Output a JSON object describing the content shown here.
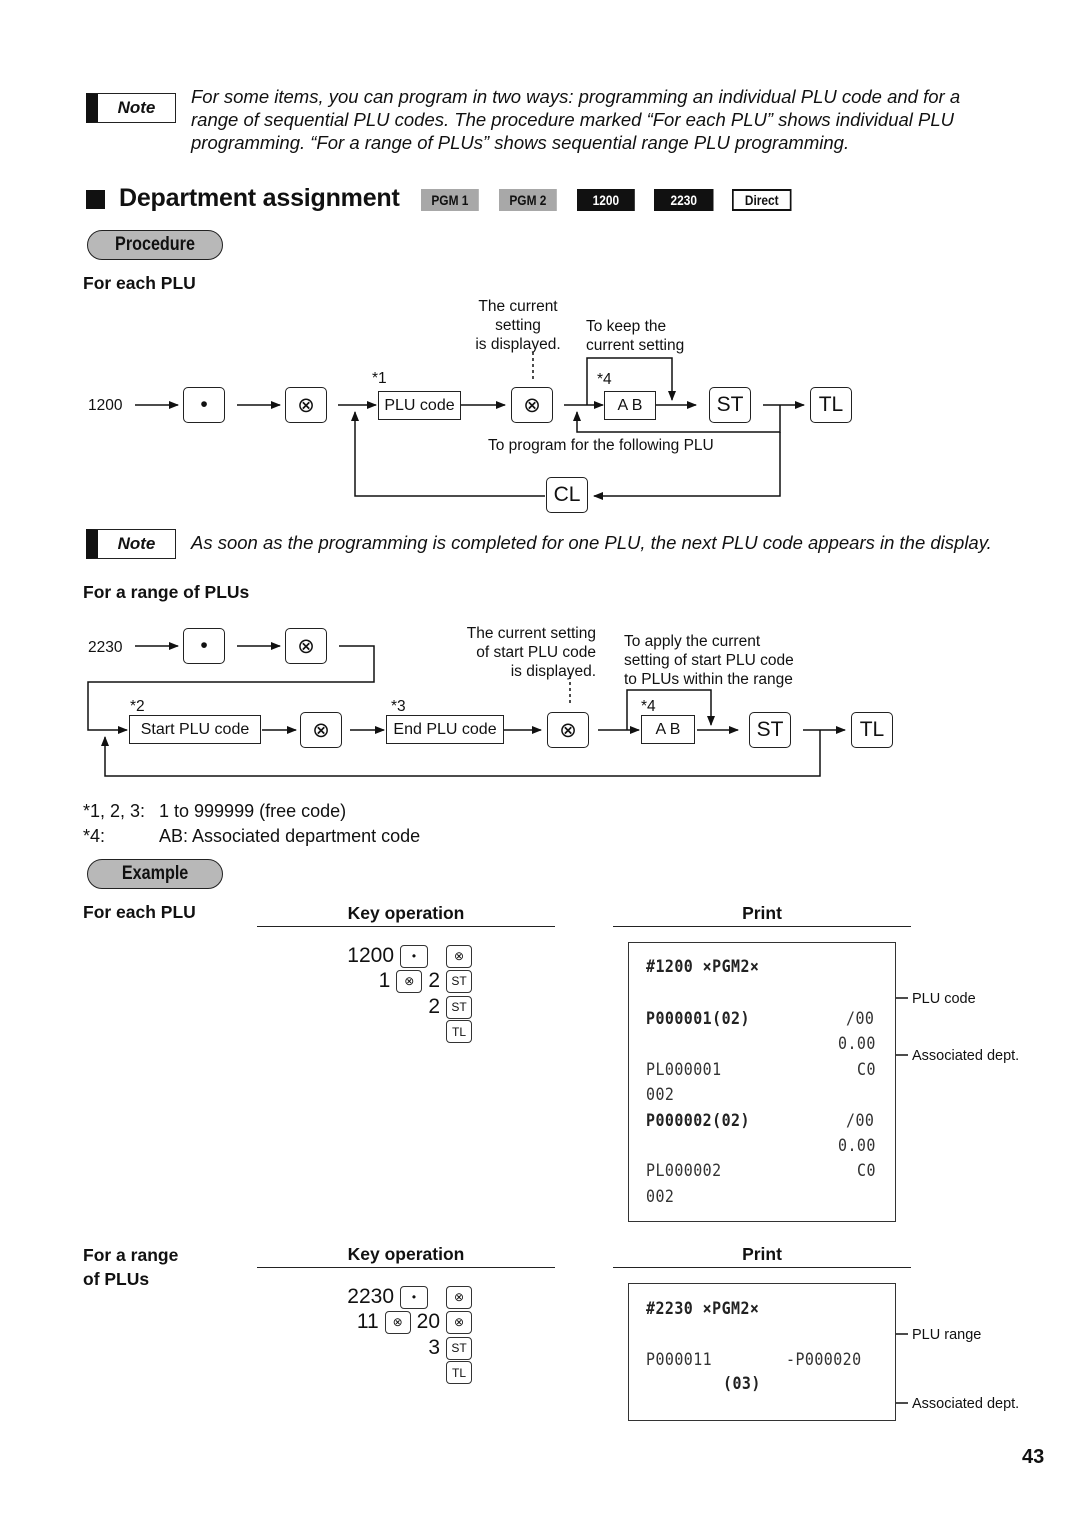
{
  "note1": {
    "badge": "Note",
    "lines": [
      "For some items, you can program in two ways: programming an individual PLU code and for a",
      "range of sequential PLU codes.  The procedure marked “For each PLU” shows individual PLU",
      "programming.  “For a range of PLUs” shows sequential range PLU programming."
    ]
  },
  "section": {
    "title": "Department assignment",
    "modes": [
      "PGM 1",
      "PGM 2",
      "1200",
      "2230",
      "Direct"
    ],
    "procedure_label": "Procedure"
  },
  "each_plu": {
    "heading": "For each PLU",
    "start_code": "1200",
    "keys": {
      "dot": "•",
      "mult": "⊗",
      "st": "ST",
      "tl": "TL",
      "cl": "CL"
    },
    "plu_box": "PLU code",
    "ab_box": "A B",
    "mark1": "*1",
    "mark4": "*4",
    "current_setting_lines": [
      "The current",
      "setting",
      "is displayed."
    ],
    "keep_lines": [
      "To keep the",
      "current setting"
    ],
    "following": "To program for the following PLU"
  },
  "note2": {
    "badge": "Note",
    "text": "As soon as the programming is completed for one PLU, the next PLU code appears in the display."
  },
  "range_plu": {
    "heading": "For a range of PLUs",
    "start_code": "2230",
    "start_box": "Start PLU code",
    "end_box": "End PLU code",
    "ab_box": "A B",
    "mark2": "*2",
    "mark3": "*3",
    "mark4": "*4",
    "current_setting_lines": [
      "The current setting",
      "of start PLU code",
      "is displayed."
    ],
    "apply_lines": [
      "To apply the current",
      "setting of start PLU code",
      "to PLUs within the range"
    ]
  },
  "footnotes": [
    {
      "mark": "*1, 2, 3:",
      "text": "1 to 999999 (free code)"
    },
    {
      "mark": "*4:",
      "text": "AB: Associated department code"
    }
  ],
  "example": {
    "label": "Example",
    "each": {
      "heading": "For each PLU",
      "key_op_header": "Key operation",
      "print_header": "Print",
      "key_ops": [
        {
          "pre": "1200",
          "k1": "•",
          "k2": "⊗"
        },
        {
          "pre": "1",
          "k1": "⊗",
          "mid": "2",
          "k2": "ST"
        },
        {
          "pre": "2",
          "k2": "ST"
        },
        {
          "k2": "TL"
        }
      ],
      "receipt": {
        "header": "#1200 ×PGM2×",
        "rows": [
          {
            "left": "P000001(02)",
            "right": "/00"
          },
          {
            "left": "",
            "right": "0.00"
          },
          {
            "left": "PL000001",
            "right": "C0"
          },
          {
            "left": "002",
            "right": ""
          },
          {
            "left": "P000002(02)",
            "right": "/00"
          },
          {
            "left": "",
            "right": "0.00"
          },
          {
            "left": "PL000002",
            "right": "C0"
          },
          {
            "left": "002",
            "right": ""
          }
        ],
        "callouts": [
          "PLU code",
          "Associated dept."
        ]
      }
    },
    "range": {
      "heading_lines": [
        "For a range",
        "of PLUs"
      ],
      "key_op_header": "Key operation",
      "print_header": "Print",
      "key_ops": [
        {
          "pre": "2230",
          "k1": "•",
          "k2": "⊗"
        },
        {
          "pre": "11",
          "k1": "⊗",
          "mid": "20",
          "k2": "⊗"
        },
        {
          "pre": "3",
          "k2": "ST"
        },
        {
          "k2": "TL"
        }
      ],
      "receipt": {
        "header": "#2230 ×PGM2×",
        "row_left": "P000011",
        "row_right": "-P000020",
        "dept": "(03)",
        "callouts": [
          "PLU range",
          "Associated dept."
        ]
      }
    }
  },
  "page_number": "43"
}
